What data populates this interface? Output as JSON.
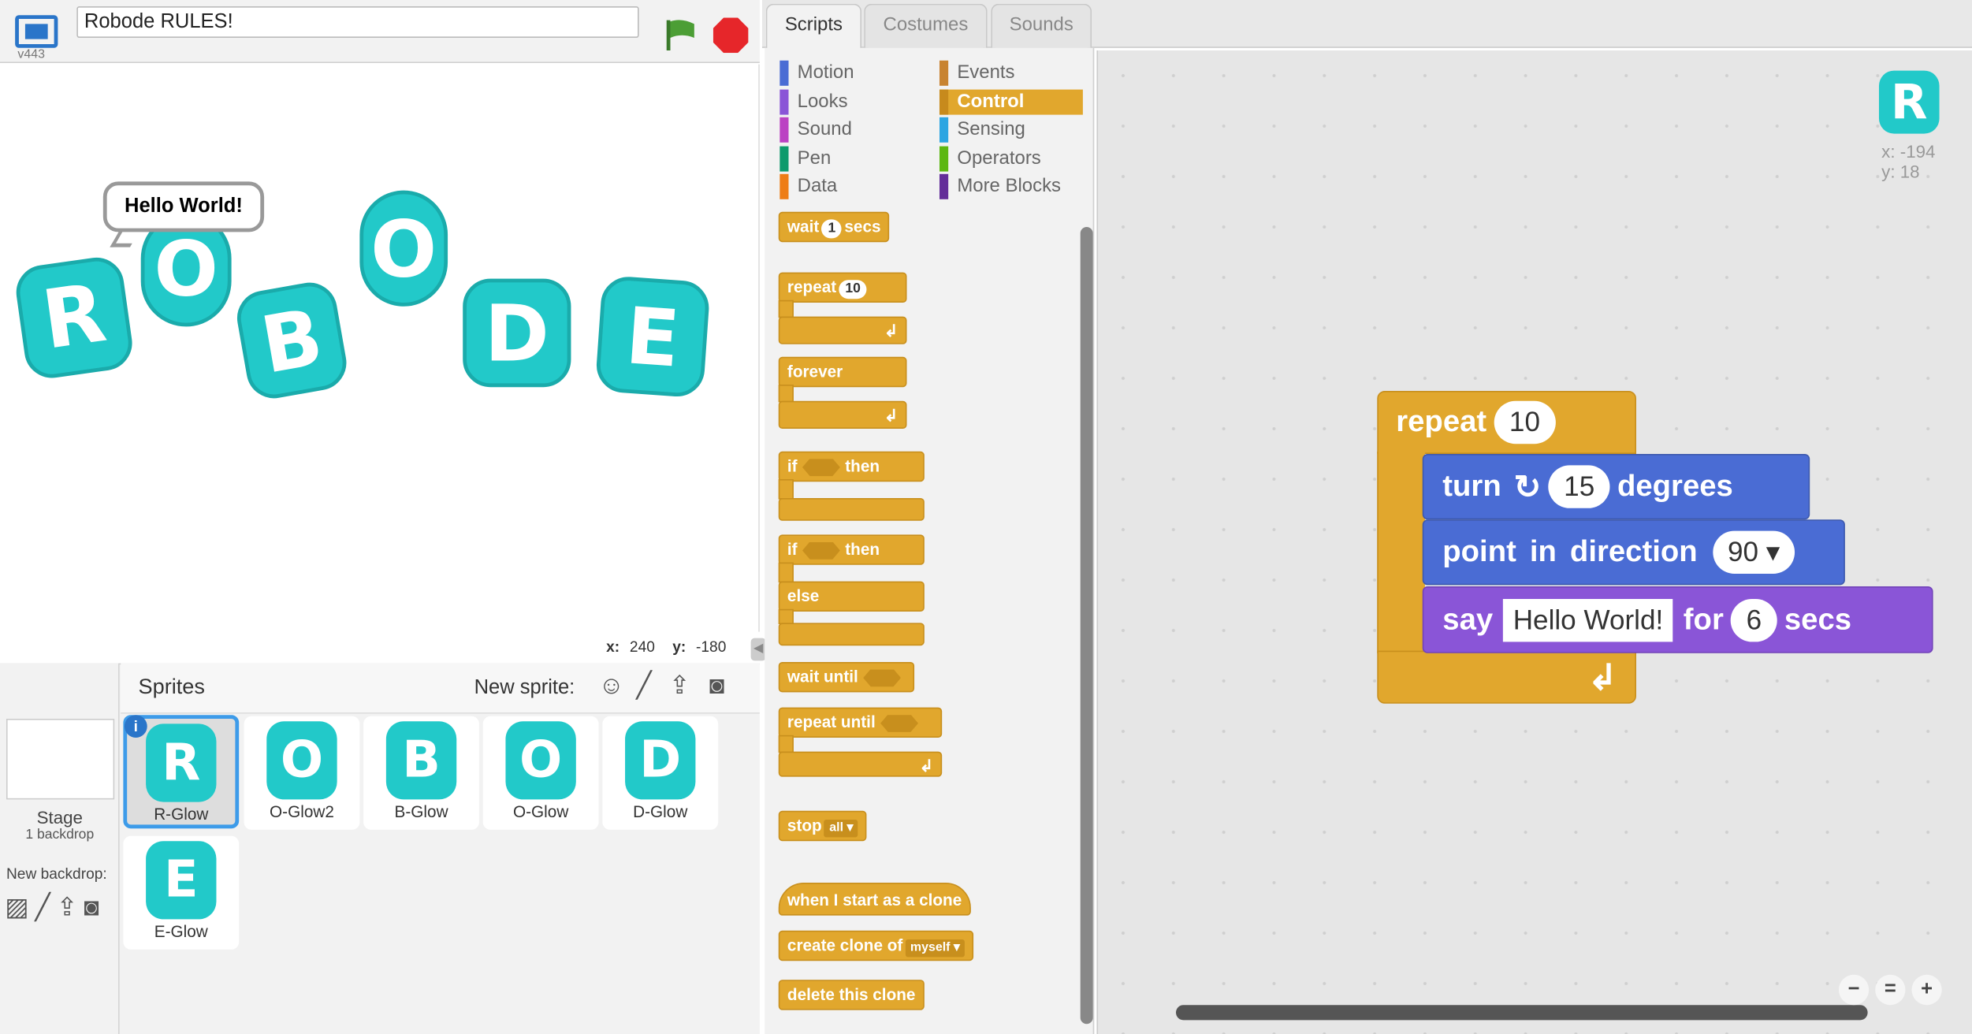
{
  "project": {
    "title": "Robode RULES!",
    "version": "v443"
  },
  "stage": {
    "letters": [
      "R",
      "O",
      "B",
      "O",
      "D",
      "E"
    ],
    "bubble": "Hello World!",
    "coords": {
      "x_label": "x:",
      "x": "240",
      "y_label": "y:",
      "y": "-180"
    }
  },
  "sprites": {
    "header": "Sprites",
    "new_sprite": "New sprite:",
    "stage_label": "Stage",
    "stage_sub": "1 backdrop",
    "new_backdrop": "New backdrop:",
    "items": [
      {
        "name": "R-Glow",
        "glyph": "R"
      },
      {
        "name": "O-Glow2",
        "glyph": "O"
      },
      {
        "name": "B-Glow",
        "glyph": "B"
      },
      {
        "name": "O-Glow",
        "glyph": "O"
      },
      {
        "name": "D-Glow",
        "glyph": "D"
      },
      {
        "name": "E-Glow",
        "glyph": "E"
      }
    ]
  },
  "tabs": [
    "Scripts",
    "Costumes",
    "Sounds"
  ],
  "categories": {
    "left": [
      {
        "label": "Motion",
        "color": "#4a6cd4"
      },
      {
        "label": "Looks",
        "color": "#8a55d7"
      },
      {
        "label": "Sound",
        "color": "#bb42c3"
      },
      {
        "label": "Pen",
        "color": "#0e9a6c"
      },
      {
        "label": "Data",
        "color": "#ee7d16"
      }
    ],
    "right": [
      {
        "label": "Events",
        "color": "#c88330"
      },
      {
        "label": "Control",
        "color": "#e1a72d"
      },
      {
        "label": "Sensing",
        "color": "#2ca5e2"
      },
      {
        "label": "Operators",
        "color": "#5cb712"
      },
      {
        "label": "More Blocks",
        "color": "#632d99"
      }
    ]
  },
  "palette": {
    "wait": "wait",
    "wait_val": "1",
    "secs": "secs",
    "repeat": "repeat",
    "repeat_val": "10",
    "forever": "forever",
    "if": "if",
    "then": "then",
    "else": "else",
    "wait_until": "wait until",
    "repeat_until": "repeat until",
    "stop": "stop",
    "stop_opt": "all",
    "when_clone": "when I start as a clone",
    "create_clone": "create clone of",
    "clone_opt": "myself",
    "delete_clone": "delete this clone"
  },
  "script": {
    "repeat": "repeat",
    "repeat_val": "10",
    "turn": "turn",
    "turn_val": "15",
    "degrees": "degrees",
    "point": "point in direction",
    "point_val": "90",
    "say": "say",
    "say_val": "Hello World!",
    "for": "for",
    "for_val": "6",
    "secs": "secs"
  },
  "corner": {
    "glyph": "R",
    "x": "x: -194",
    "y": "y: 18"
  },
  "colors": {
    "control": "#e1a72d",
    "motion": "#4a6cd4",
    "looks": "#8a55d7",
    "sprite": "#22c9c9"
  }
}
